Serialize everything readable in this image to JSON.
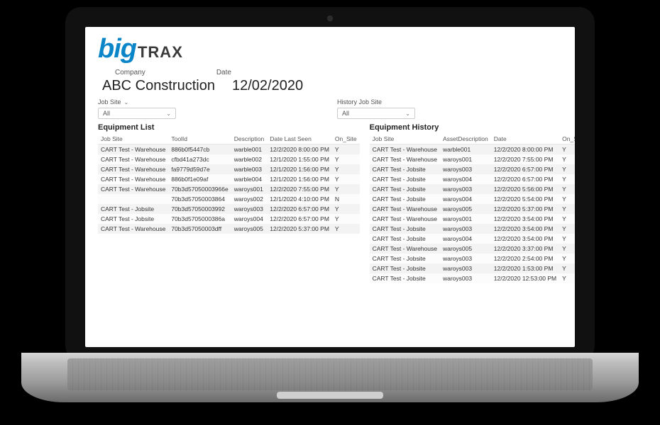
{
  "logo": {
    "big": "big",
    "trax": "TRAX"
  },
  "labels": {
    "company": "Company",
    "date": "Date"
  },
  "values": {
    "company": "ABC Construction",
    "date": "12/02/2020"
  },
  "filters": {
    "left": {
      "label": "Job Site",
      "value": "All"
    },
    "right": {
      "label": "History Job Site",
      "value": "All"
    }
  },
  "equipment_list": {
    "title": "Equipment List",
    "headers": [
      "Job Site",
      "ToolId",
      "Description",
      "Date Last Seen",
      "On_Site"
    ],
    "rows": [
      [
        "CART Test - Warehouse",
        "886b0f5447cb",
        "warble001",
        "12/2/2020 8:00:00 PM",
        "Y"
      ],
      [
        "CART Test - Warehouse",
        "cfbd41a273dc",
        "warble002",
        "12/1/2020 1:55:00 PM",
        "Y"
      ],
      [
        "CART Test - Warehouse",
        "fa9779d59d7e",
        "warble003",
        "12/1/2020 1:56:00 PM",
        "Y"
      ],
      [
        "CART Test - Warehouse",
        "886b0f1e09af",
        "warble004",
        "12/1/2020 1:56:00 PM",
        "Y"
      ],
      [
        "CART Test - Warehouse",
        "70b3d57050003966e",
        "waroys001",
        "12/2/2020 7:55:00 PM",
        "Y"
      ],
      [
        "",
        "70b3d57050003864",
        "waroys002",
        "12/1/2020 4:10:00 PM",
        "N"
      ],
      [
        "CART Test - Jobsite",
        "70b3d57050003992",
        "waroys003",
        "12/2/2020 6:57:00 PM",
        "Y"
      ],
      [
        "CART Test - Jobsite",
        "70b3d5705000386a",
        "waroys004",
        "12/2/2020 6:57:00 PM",
        "Y"
      ],
      [
        "CART Test - Warehouse",
        "70b3d57050003dff",
        "waroys005",
        "12/2/2020 5:37:00 PM",
        "Y"
      ]
    ]
  },
  "equipment_history": {
    "title": "Equipment History",
    "headers": [
      "Job Site",
      "AssetDescription",
      "Date",
      "On_Site"
    ],
    "rows": [
      [
        "CART Test - Warehouse",
        "warble001",
        "12/2/2020 8:00:00 PM",
        "Y"
      ],
      [
        "CART Test - Warehouse",
        "waroys001",
        "12/2/2020 7:55:00 PM",
        "Y"
      ],
      [
        "CART Test - Jobsite",
        "waroys003",
        "12/2/2020 6:57:00 PM",
        "Y"
      ],
      [
        "CART Test - Jobsite",
        "waroys004",
        "12/2/2020 6:57:00 PM",
        "Y"
      ],
      [
        "CART Test - Jobsite",
        "waroys003",
        "12/2/2020 5:56:00 PM",
        "Y"
      ],
      [
        "CART Test - Jobsite",
        "waroys004",
        "12/2/2020 5:54:00 PM",
        "Y"
      ],
      [
        "CART Test - Warehouse",
        "waroys005",
        "12/2/2020 5:37:00 PM",
        "Y"
      ],
      [
        "CART Test - Warehouse",
        "waroys001",
        "12/2/2020 3:54:00 PM",
        "Y"
      ],
      [
        "CART Test - Jobsite",
        "waroys003",
        "12/2/2020 3:54:00 PM",
        "Y"
      ],
      [
        "CART Test - Jobsite",
        "waroys004",
        "12/2/2020 3:54:00 PM",
        "Y"
      ],
      [
        "CART Test - Warehouse",
        "waroys005",
        "12/2/2020 3:37:00 PM",
        "Y"
      ],
      [
        "CART Test - Jobsite",
        "waroys003",
        "12/2/2020 2:54:00 PM",
        "Y"
      ],
      [
        "CART Test - Jobsite",
        "waroys003",
        "12/2/2020 1:53:00 PM",
        "Y"
      ],
      [
        "CART Test - Jobsite",
        "waroys003",
        "12/2/2020 12:53:00 PM",
        "Y"
      ]
    ]
  }
}
